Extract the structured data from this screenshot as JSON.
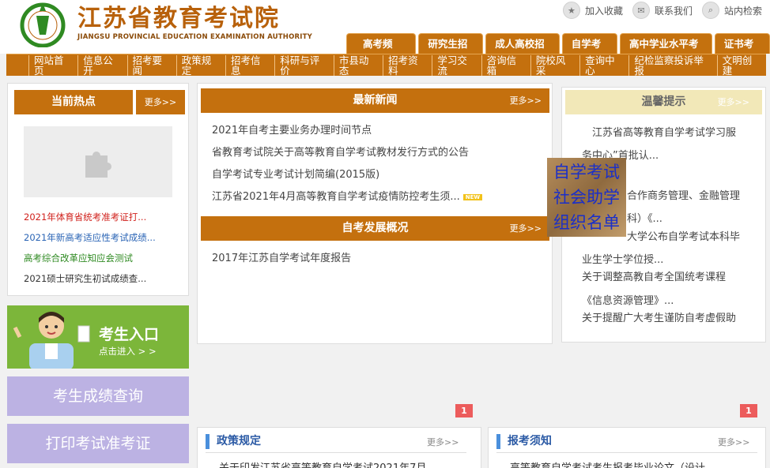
{
  "header": {
    "title": "江苏省教育考试院",
    "subtitle": "JIANGSU PROVINCIAL EDUCATION EXAMINATION AUTHORITY",
    "top_links": [
      {
        "label": "加入收藏",
        "icon": "star-icon"
      },
      {
        "label": "联系我们",
        "icon": "mail-icon"
      },
      {
        "label": "站内检索",
        "icon": "search-icon"
      }
    ],
    "tabs": [
      "高考频道",
      "研究生招生",
      "成人高校招生",
      "自学考试",
      "高中学业水平考试",
      "证书考试"
    ]
  },
  "nav": [
    "网站首页",
    "信息公开",
    "招考要闻",
    "政策规定",
    "招考信息",
    "科研与评价",
    "市县动态",
    "招考资料",
    "学习交流",
    "咨询信箱",
    "院校风采",
    "查询中心",
    "纪检监察投诉举报",
    "文明创建"
  ],
  "hot": {
    "title": "当前热点",
    "more": "更多>>",
    "items": [
      {
        "text": "2021年体育省统考准考证打...",
        "color": "#d0201b"
      },
      {
        "text": "2021年新高考适应性考试成绩...",
        "color": "#2a64b5"
      },
      {
        "text": "高考综合改革应知应会测试",
        "color": "#2f8a22"
      },
      {
        "text": "2021硕士研究生初试成绩查...",
        "color": "#333333"
      }
    ]
  },
  "entry": {
    "title": "考生入口",
    "sub": "点击进入 > >"
  },
  "buttons": {
    "score": "考生成绩查询",
    "admit": "打印考试准考证"
  },
  "news": {
    "title": "最新新闻",
    "more": "更多>>",
    "items": [
      "2021年自考主要业务办理时间节点",
      "省教育考试院关于高等教育自学考试教材发行方式的公告",
      "自学考试专业考试计划简编(2015版)",
      "江苏省2021年4月高等教育自学考试疫情防控考生须..."
    ],
    "new_badge": "NEW"
  },
  "dev": {
    "title": "自考发展概况",
    "more": "更多>>",
    "items": [
      "2017年江苏自学考试年度报告"
    ]
  },
  "tips": {
    "title": "温馨提示",
    "more": "更多>>",
    "lines": [
      "江苏省高等教育自学考试学习服",
      "务中心”首批认...",
      "合作商务管理、金融管理",
      "科）《...",
      "大学公布自学考试本科毕",
      "业生学士学位授...",
      "关于调整高教自考全国统考课程",
      "《信息资源管理》...",
      "关于提醒广大考生谨防自考虚假助"
    ]
  },
  "overlay": {
    "lines": [
      "自学考试",
      "社会助学",
      "组织名单"
    ]
  },
  "pagers": {
    "left": "1",
    "right": "1"
  },
  "bottom": {
    "policy": {
      "title": "政策规定",
      "more": "更多>>",
      "text": "关于印发江苏省高等教育自学考试2021年7月"
    },
    "notice": {
      "title": "报考须知",
      "more": "更多>>",
      "text": "高等教育自学考试考生报考毕业论文（设计"
    }
  },
  "colors": {
    "brand": "#c4700e",
    "green": "#7cb63a",
    "lilac": "#bcb2e3",
    "tipbar": "#f2e8b8",
    "blue": "#2b5aa5"
  }
}
